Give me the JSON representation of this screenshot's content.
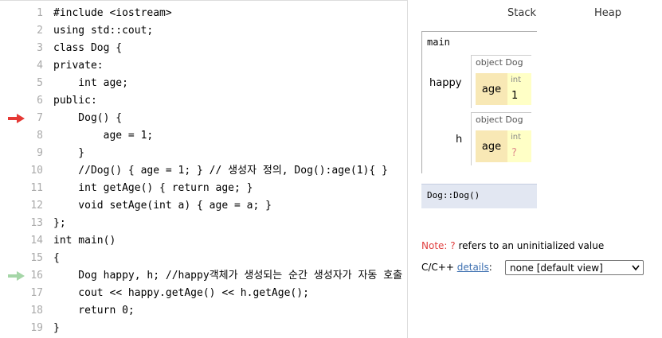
{
  "code": {
    "lines": [
      {
        "no": "1",
        "text": "#include <iostream>"
      },
      {
        "no": "2",
        "text": "using std::cout;"
      },
      {
        "no": "3",
        "text": "class Dog {"
      },
      {
        "no": "4",
        "text": "private:"
      },
      {
        "no": "5",
        "text": "    int age;"
      },
      {
        "no": "6",
        "text": "public:"
      },
      {
        "no": "7",
        "text": "    Dog() {"
      },
      {
        "no": "8",
        "text": "        age = 1;"
      },
      {
        "no": "9",
        "text": "    }"
      },
      {
        "no": "10",
        "text": "    //Dog() { age = 1; } // 생성자 정의, Dog():age(1){ }"
      },
      {
        "no": "11",
        "text": "    int getAge() { return age; }"
      },
      {
        "no": "12",
        "text": "    void setAge(int a) { age = a; }"
      },
      {
        "no": "13",
        "text": "};"
      },
      {
        "no": "14",
        "text": "int main()"
      },
      {
        "no": "15",
        "text": "{"
      },
      {
        "no": "16",
        "text": "    Dog happy, h; //happy객체가 생성되는 순간 생성자가 자동 호출"
      },
      {
        "no": "17",
        "text": "    cout << happy.getAge() << h.getAge();"
      },
      {
        "no": "18",
        "text": "    return 0;"
      },
      {
        "no": "19",
        "text": "}"
      }
    ],
    "current_line_arrow_color": "#e53935",
    "next_line_arrow_color": "#a5d6a7"
  },
  "viz": {
    "stack_header": "Stack",
    "heap_header": "Heap",
    "frame_main": "main",
    "vars": [
      {
        "name": "happy",
        "obj_title": "object Dog",
        "key": "age",
        "type": "int",
        "value": "1"
      },
      {
        "name": "h",
        "obj_title": "object Dog",
        "key": "age",
        "type": "int",
        "value": "?"
      }
    ],
    "inactive_frame": "Dog::Dog()"
  },
  "footer": {
    "note_label": "Note:",
    "note_q": "?",
    "note_text": "refers to an uninitialized value",
    "cc_label": "C/C++",
    "details_link": "details",
    "colon": ":",
    "view_option": "none [default view]"
  }
}
